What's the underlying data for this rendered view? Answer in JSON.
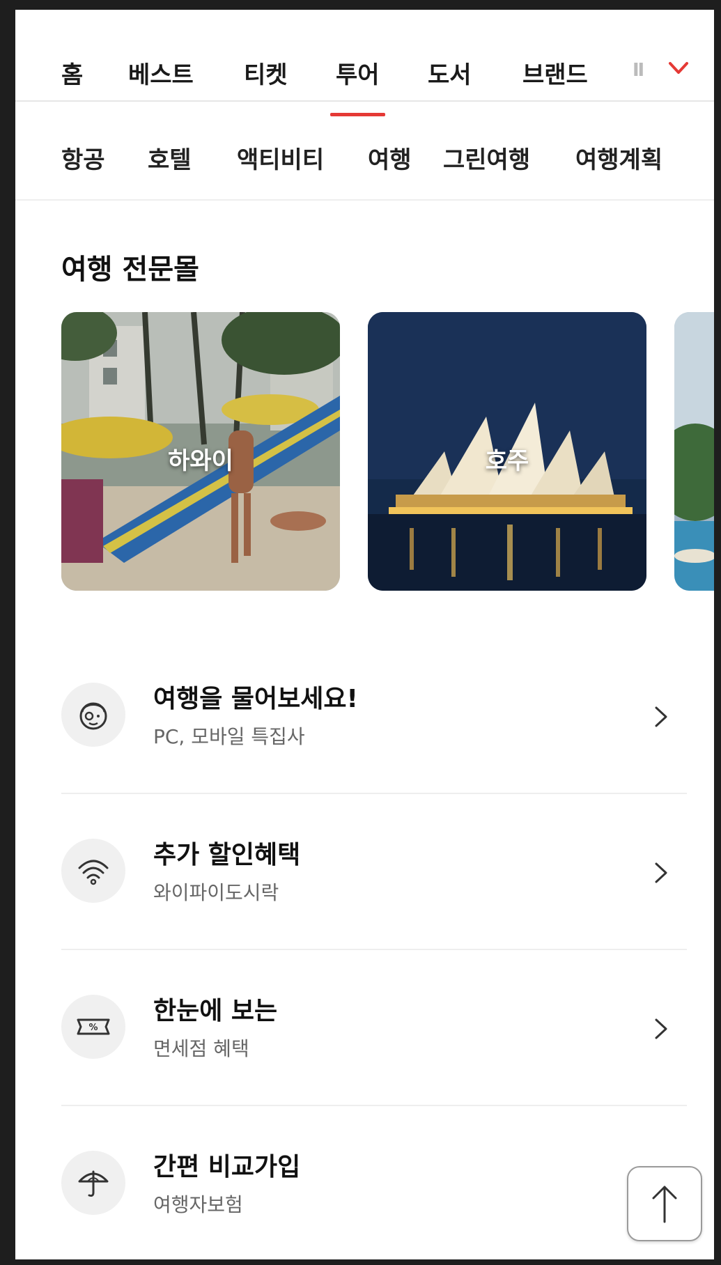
{
  "top_nav": {
    "tabs": [
      {
        "label": "홈"
      },
      {
        "label": "베스트"
      },
      {
        "label": "티켓"
      },
      {
        "label": "투어",
        "active": true
      },
      {
        "label": "도서"
      },
      {
        "label": "브랜드"
      }
    ],
    "overflow_text": "Ⅱ",
    "expand_icon": "chevron-down-icon",
    "accent_color": "#e53935"
  },
  "sub_nav": {
    "items": [
      "항공",
      "호텔",
      "액티비티",
      "여행",
      "그린여행",
      "여행계획"
    ]
  },
  "section": {
    "title": "여행 전문몰",
    "cards": [
      {
        "label": "하와이"
      },
      {
        "label": "호주"
      },
      {
        "label": ""
      }
    ]
  },
  "list": [
    {
      "title": "여행을 물어보세요!",
      "subtitle": "PC, 모바일 특집사",
      "icon": "face-icon"
    },
    {
      "title": "추가 할인혜택",
      "subtitle": "와이파이도시락",
      "icon": "wifi-icon"
    },
    {
      "title": "한눈에 보는",
      "subtitle": "면세점 혜택",
      "icon": "percent-ticket-icon"
    },
    {
      "title": "간편 비교가입",
      "subtitle": "여행자보험",
      "icon": "umbrella-icon"
    }
  ],
  "scroll_top": {
    "icon": "arrow-up-icon"
  }
}
